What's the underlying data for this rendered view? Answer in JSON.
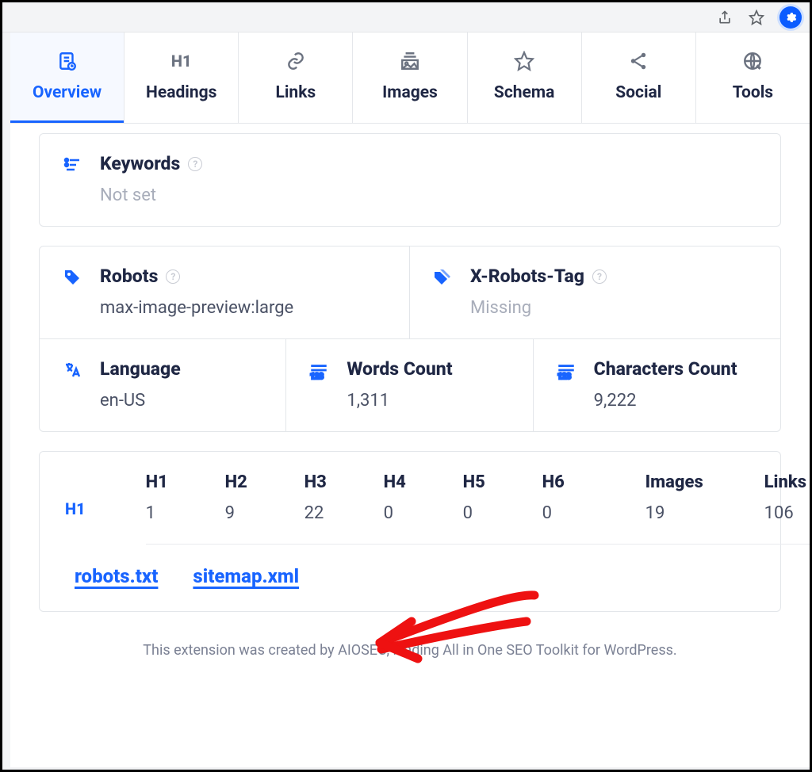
{
  "tabs": [
    {
      "label": "Overview"
    },
    {
      "label": "Headings"
    },
    {
      "label": "Links"
    },
    {
      "label": "Images"
    },
    {
      "label": "Schema"
    },
    {
      "label": "Social"
    },
    {
      "label": "Tools"
    }
  ],
  "keywords": {
    "title": "Keywords",
    "value": "Not set"
  },
  "robots": {
    "title": "Robots",
    "value": "max-image-preview:large"
  },
  "xrobots": {
    "title": "X-Robots-Tag",
    "value": "Missing"
  },
  "language": {
    "title": "Language",
    "value": "en-US"
  },
  "words": {
    "title": "Words Count",
    "value": "1,311"
  },
  "chars": {
    "title": "Characters Count",
    "value": "9,222"
  },
  "stats": [
    {
      "label": "H1",
      "value": "1"
    },
    {
      "label": "H2",
      "value": "9"
    },
    {
      "label": "H3",
      "value": "22"
    },
    {
      "label": "H4",
      "value": "0"
    },
    {
      "label": "H5",
      "value": "0"
    },
    {
      "label": "H6",
      "value": "0"
    },
    {
      "label": "Images",
      "value": "19"
    },
    {
      "label": "Links",
      "value": "106"
    }
  ],
  "links": {
    "robots": "robots.txt",
    "sitemap": "sitemap.xml"
  },
  "footer": "This extension was created by AIOSEO, leading All in One SEO Toolkit for WordPress."
}
